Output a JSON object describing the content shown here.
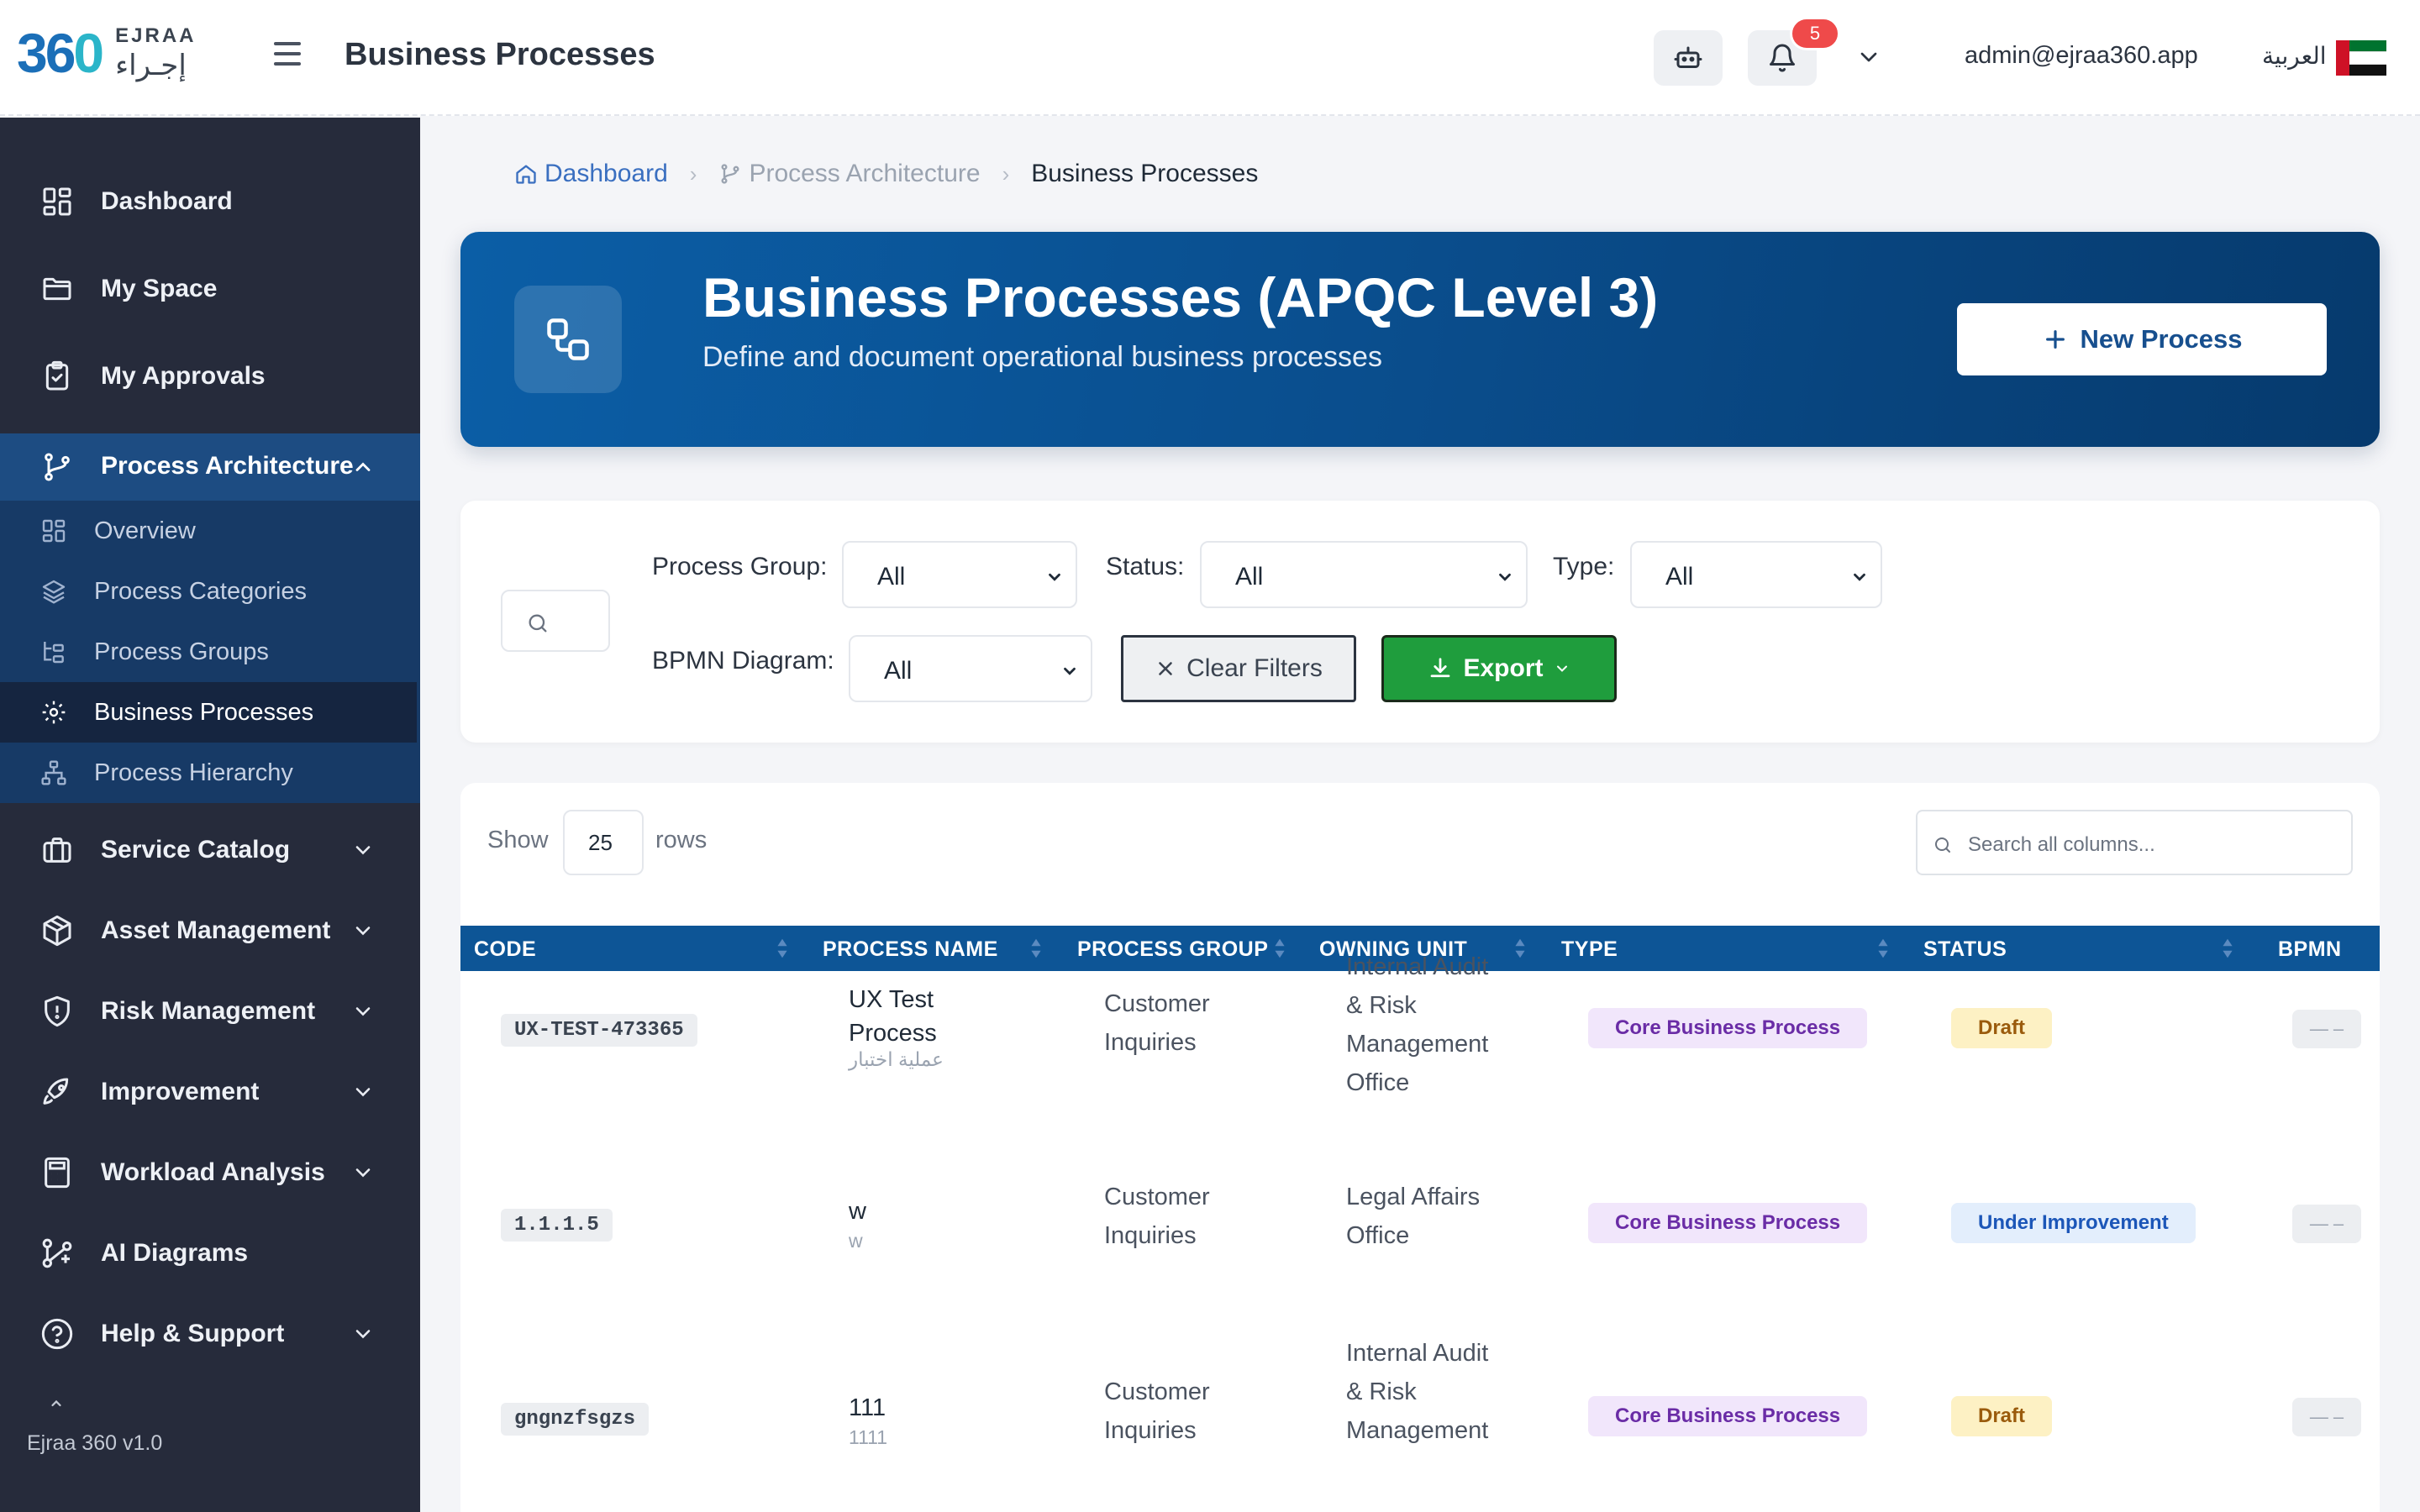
{
  "brand": {
    "num_main": "36",
    "num_accent": "0",
    "name_en": "EJRAA",
    "name_ar": "إجـراء"
  },
  "topbar": {
    "title": "Business Processes",
    "notification_count": "5",
    "user_email": "admin@ejraa360.app",
    "language_label": "العربية"
  },
  "sidebar": {
    "items": [
      {
        "label": "Dashboard"
      },
      {
        "label": "My Space"
      },
      {
        "label": "My Approvals"
      },
      {
        "label": "Process Architecture"
      },
      {
        "label": "Service Catalog"
      },
      {
        "label": "Asset Management"
      },
      {
        "label": "Risk Management"
      },
      {
        "label": "Improvement"
      },
      {
        "label": "Workload Analysis"
      },
      {
        "label": "AI Diagrams"
      },
      {
        "label": "Help & Support"
      }
    ],
    "sub_items": [
      {
        "label": "Overview"
      },
      {
        "label": "Process Categories"
      },
      {
        "label": "Process Groups"
      },
      {
        "label": "Business Processes"
      },
      {
        "label": "Process Hierarchy"
      }
    ],
    "version": "Ejraa 360 v1.0"
  },
  "breadcrumb": {
    "home": "Dashboard",
    "parent": "Process Architecture",
    "current": "Business Processes"
  },
  "hero": {
    "title": "Business Processes (APQC Level 3)",
    "subtitle": "Define and document operational business processes",
    "new_button": "New Process"
  },
  "filters": {
    "process_group_label": "Process Group:",
    "process_group_value": "All",
    "status_label": "Status:",
    "status_value": "All",
    "type_label": "Type:",
    "type_value": "All",
    "bpmn_label": "BPMN Diagram:",
    "bpmn_value": "All",
    "clear_label": "Clear Filters",
    "export_label": "Export"
  },
  "table": {
    "show_label": "Show",
    "rows_value": "25",
    "rows_label": "rows",
    "search_placeholder": "Search all columns...",
    "headers": [
      "CODE",
      "PROCESS NAME",
      "PROCESS GROUP",
      "OWNING UNIT",
      "TYPE",
      "STATUS",
      "BPMN"
    ],
    "rows": [
      {
        "code": "UX-TEST-473365",
        "name_line1": "UX Test",
        "name_line2": "Process",
        "name_ar": "عملية اختبار",
        "group_line1": "Customer",
        "group_line2": "Inquiries",
        "unit_line1": "Internal Audit",
        "unit_line2": "& Risk",
        "unit_line3": "Management",
        "unit_line4": "Office",
        "type": "Core Business Process",
        "status": "Draft",
        "bpmn": "— –"
      },
      {
        "code": "1.1.1.5",
        "name_line1": "w",
        "name_ar": "w",
        "group_line1": "Customer",
        "group_line2": "Inquiries",
        "unit_line1": "Legal Affairs",
        "unit_line2": "Office",
        "type": "Core Business Process",
        "status": "Under Improvement",
        "bpmn": "— –"
      },
      {
        "code": "gngnzfsgzs",
        "name_line1": "111",
        "name_ar": "1111",
        "group_line1": "Customer",
        "group_line2": "Inquiries",
        "unit_line1": "Internal Audit",
        "unit_line2": "& Risk",
        "unit_line3": "Management",
        "type": "Core Business Process",
        "status": "Draft",
        "bpmn": "— –"
      }
    ]
  },
  "colors": {
    "sidebar_bg": "#262b3b",
    "sidebar_active_section": "#1d4c82",
    "hero_gradient_start": "#0b5ea6",
    "hero_gradient_end": "#063a6d",
    "table_header": "#0d5596",
    "export_green": "#1f9d3d",
    "badge_red": "#ef4a4a"
  },
  "icons": {
    "menu": "hamburger-icon",
    "robot": "robot-icon",
    "notifications": "bell-icon",
    "dropdown": "chevron-down-icon",
    "flag": "uae-flag-icon",
    "hero": "process-flow-icon",
    "search": "search-icon",
    "clear": "x-icon",
    "export": "download-icon",
    "add": "plus-icon"
  }
}
